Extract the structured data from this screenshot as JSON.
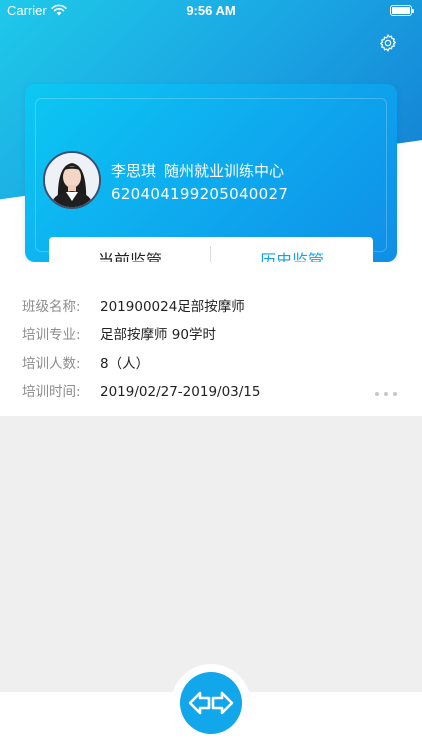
{
  "status_bar": {
    "carrier": "Carrier",
    "time": "9:56 AM"
  },
  "header": {
    "settings_icon": "gear-icon"
  },
  "profile": {
    "name": "李思琪",
    "center": "随州就业训练中心",
    "id_number": "620404199205040027"
  },
  "tabs": [
    {
      "label": "当前监管",
      "active": true
    },
    {
      "label": "历史监管",
      "active": false
    }
  ],
  "info": {
    "class_name": {
      "label": "班级名称:",
      "value": "201900024足部按摩师"
    },
    "major": {
      "label": "培训专业:",
      "value": "足部按摩师 90学时"
    },
    "count": {
      "label": "培训人数:",
      "value": "8（人）"
    },
    "period": {
      "label": "培训时间:",
      "value": "2019/02/27-2019/03/15"
    }
  },
  "fab": {
    "icon": "switch-arrows-icon"
  },
  "colors": {
    "accent": "#12a6ea",
    "header_start": "#1fc9e9",
    "header_end": "#1277cf"
  }
}
